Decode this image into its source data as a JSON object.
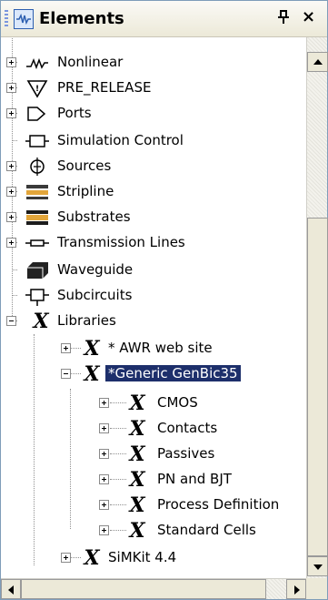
{
  "panel": {
    "title": "Elements",
    "pin_glyph": "ꟸ",
    "close_glyph": "×"
  },
  "tree": [
    {
      "label": "Nonlinear",
      "icon": "nonlinear-icon",
      "expander": "plus"
    },
    {
      "label": "PRE_RELEASE",
      "icon": "pre-release-icon",
      "expander": "plus"
    },
    {
      "label": "Ports",
      "icon": "ports-icon",
      "expander": "plus"
    },
    {
      "label": "Simulation Control",
      "icon": "simulation-control-icon",
      "expander": "none"
    },
    {
      "label": "Sources",
      "icon": "sources-icon",
      "expander": "plus"
    },
    {
      "label": "Stripline",
      "icon": "stripline-icon",
      "expander": "plus"
    },
    {
      "label": "Substrates",
      "icon": "substrates-icon",
      "expander": "plus"
    },
    {
      "label": "Transmission Lines",
      "icon": "transmission-lines-icon",
      "expander": "plus"
    },
    {
      "label": "Waveguide",
      "icon": "waveguide-icon",
      "expander": "none"
    },
    {
      "label": "Subcircuits",
      "icon": "subcircuits-icon",
      "expander": "none"
    },
    {
      "label": "Libraries",
      "icon": "library-icon",
      "expander": "minus"
    },
    {
      "label": "* AWR web site",
      "icon": "library-icon",
      "expander": "plus"
    },
    {
      "label": "*Generic GenBic35",
      "icon": "library-icon",
      "expander": "minus",
      "selected": true
    },
    {
      "label": "CMOS",
      "icon": "library-icon",
      "expander": "plus"
    },
    {
      "label": "Contacts",
      "icon": "library-icon",
      "expander": "plus"
    },
    {
      "label": "Passives",
      "icon": "library-icon",
      "expander": "plus"
    },
    {
      "label": "PN and BJT",
      "icon": "library-icon",
      "expander": "plus"
    },
    {
      "label": "Process Definition",
      "icon": "library-icon",
      "expander": "plus"
    },
    {
      "label": "Standard Cells",
      "icon": "library-icon",
      "expander": "plus"
    },
    {
      "label": "SiMKit 4.4",
      "icon": "library-icon",
      "expander": "plus"
    }
  ],
  "colors": {
    "selection": "#1d2f6b",
    "accent": "#2d5fb0"
  }
}
